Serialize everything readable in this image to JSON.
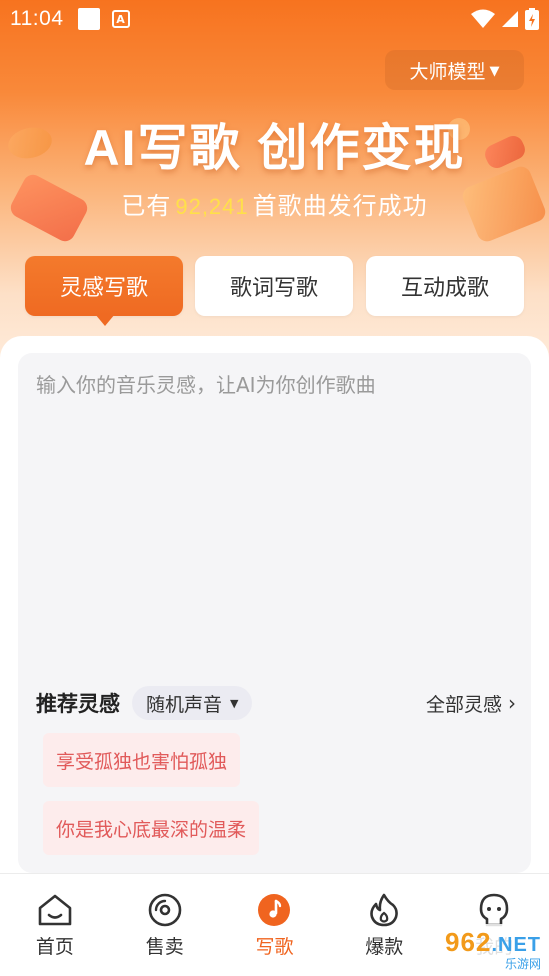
{
  "status_bar": {
    "time": "11:04",
    "app_badge": "A"
  },
  "header": {
    "model_label": "大师模型",
    "title": "AI写歌 创作变现",
    "subtitle_prefix": "已有",
    "song_count": "92,241",
    "subtitle_suffix": "首歌曲发行成功"
  },
  "tabs": [
    {
      "label": "灵感写歌",
      "active": true
    },
    {
      "label": "歌词写歌",
      "active": false
    },
    {
      "label": "互动成歌",
      "active": false
    }
  ],
  "input": {
    "placeholder": "输入你的音乐灵感，让AI为你创作歌曲",
    "value": ""
  },
  "recommend": {
    "title": "推荐灵感",
    "voice_select": "随机声音",
    "all_link": "全部灵感",
    "items": [
      "享受孤独也害怕孤独",
      "你是我心底最深的温柔"
    ]
  },
  "bottom_nav": [
    {
      "label": "首页",
      "icon": "home-icon",
      "active": false
    },
    {
      "label": "售卖",
      "icon": "disc-icon",
      "active": false
    },
    {
      "label": "写歌",
      "icon": "music-note-icon",
      "active": true
    },
    {
      "label": "爆款",
      "icon": "flame-icon",
      "active": false
    },
    {
      "label": "我的",
      "icon": "profile-icon",
      "active": false
    }
  ],
  "watermark": {
    "main": "962",
    "net": ".NET",
    "sub": "乐游网"
  },
  "colors": {
    "accent": "#f0641f",
    "hero_top": "#f7731f",
    "count_highlight": "#ffe04a",
    "chip_text": "#e15a5a",
    "chip_bg": "#fdecec"
  }
}
